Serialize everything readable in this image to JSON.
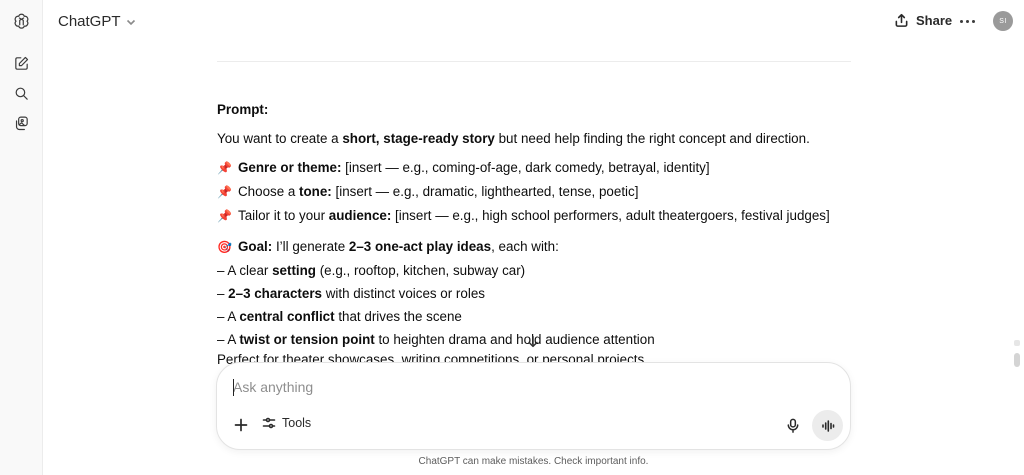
{
  "header": {
    "model_name": "ChatGPT",
    "share_label": "Share",
    "avatar_initials": "SI"
  },
  "sidebar": {
    "items": [
      {
        "icon": "openai-logo-icon"
      },
      {
        "icon": "new-chat-icon"
      },
      {
        "icon": "search-icon"
      },
      {
        "icon": "library-icon"
      }
    ]
  },
  "message": {
    "heading": "Prompt:",
    "intro": {
      "pre": "You want to create a ",
      "bold": "short, stage-ready story",
      "post": " but need help finding the right concept and direction."
    },
    "pins": [
      {
        "emoji": "📌",
        "pre": "",
        "bold": "Genre or theme:",
        "post": " [insert — e.g., coming-of-age, dark comedy, betrayal, identity]"
      },
      {
        "emoji": "📌",
        "pre": "Choose a ",
        "bold": "tone:",
        "post": " [insert — e.g., dramatic, lighthearted, tense, poetic]"
      },
      {
        "emoji": "📌",
        "pre": "Tailor it to your ",
        "bold": "audience:",
        "post": " [insert — e.g., high school performers, adult theatergoers, festival judges]"
      }
    ],
    "goal": {
      "emoji": "🎯",
      "bold1": "Goal:",
      "mid": " I’ll generate ",
      "bold2": "2–3 one-act play ideas",
      "post": ", each with:"
    },
    "bullets": [
      {
        "pre": "– A clear ",
        "bold": "setting",
        "post": " (e.g., rooftop, kitchen, subway car)"
      },
      {
        "pre": "– ",
        "bold": "2–3 characters",
        "post": " with distinct voices or roles"
      },
      {
        "pre": "– A ",
        "bold": "central conflict",
        "post": " that drives the scene"
      },
      {
        "pre": "– A ",
        "bold": "twist or tension point",
        "post": " to heighten drama and hold audience attention"
      }
    ],
    "cutoff_line": "Perfect for theater showcases, writing competitions, or personal projects."
  },
  "composer": {
    "placeholder": "Ask anything",
    "tools_label": "Tools"
  },
  "footer": {
    "disclaimer": "ChatGPT can make mistakes. Check important info."
  },
  "colors": {
    "background": "#ffffff",
    "sidebar_bg": "#f9f9f9",
    "text": "#0d0d0d",
    "muted": "#8e8e8e"
  }
}
